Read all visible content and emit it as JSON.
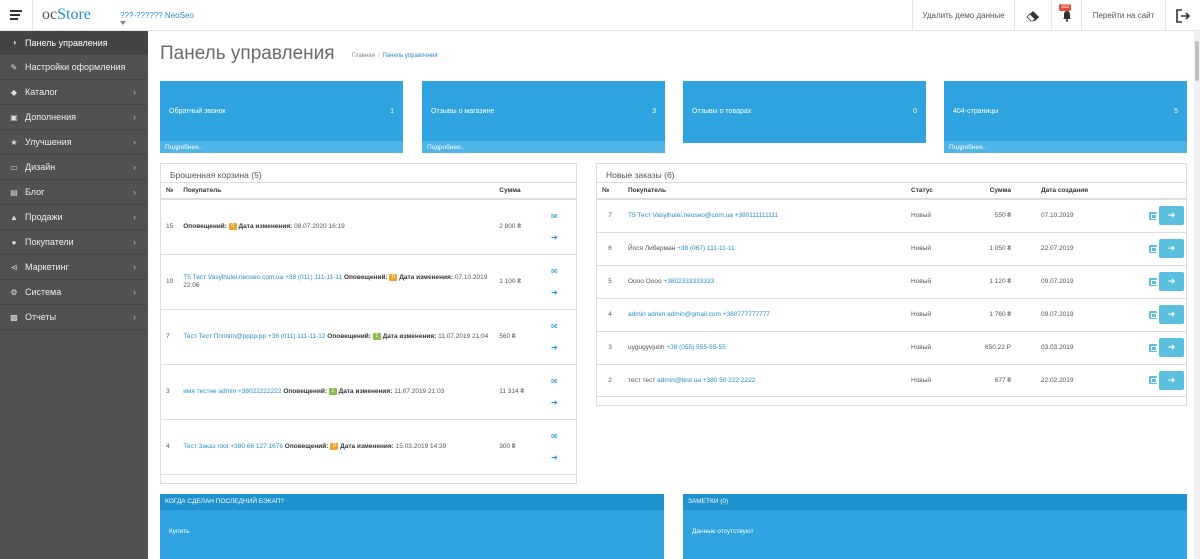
{
  "header": {
    "logo_prefix": "oc",
    "logo_main": "Store",
    "store_name": "???-?????? NeoSeo",
    "delete_demo": "Удалить демо данные",
    "notif_count": "332",
    "go_to_site": "Перейти на сайт"
  },
  "sidebar": {
    "items": [
      {
        "label": "Панель управления",
        "icon": "dashboard-icon"
      },
      {
        "label": "Настройки оформления",
        "icon": "brush-icon"
      },
      {
        "label": "Каталог",
        "icon": "tag-icon"
      },
      {
        "label": "Дополнения",
        "icon": "puzzle-icon"
      },
      {
        "label": "Улучшения",
        "icon": "star-icon"
      },
      {
        "label": "Дизайн",
        "icon": "monitor-icon"
      },
      {
        "label": "Блог",
        "icon": "blog-icon"
      },
      {
        "label": "Продажи",
        "icon": "cart-icon"
      },
      {
        "label": "Покупатели",
        "icon": "user-icon"
      },
      {
        "label": "Маркетинг",
        "icon": "share-icon"
      },
      {
        "label": "Система",
        "icon": "cog-icon"
      },
      {
        "label": "Отчеты",
        "icon": "bar-chart-icon"
      }
    ]
  },
  "page": {
    "title": "Панель управления",
    "breadcrumb_home": "Главная",
    "breadcrumb_current": "Панель управления"
  },
  "tiles": [
    {
      "title": "Обратный звонок",
      "value": "1",
      "more": "Подробнее.."
    },
    {
      "title": "Отзывы о магазине",
      "value": "3",
      "more": "Подробнее.."
    },
    {
      "title": "Отзывы о товарах",
      "value": "0",
      "more": ""
    },
    {
      "title": "404-страницы",
      "value": "5",
      "more": "Подробнее.."
    }
  ],
  "abandoned": {
    "title": "Брошенная корзина (5)",
    "cols": {
      "num": "№",
      "customer": "Покупатель",
      "sum": "Сумма"
    },
    "notif_label": "Оповещений:",
    "date_label": "Дата изменения:",
    "rows": [
      {
        "num": "15",
        "customer": "",
        "notif": "0",
        "date": "08.07.2020 16:19",
        "sum": "2 800 ₴"
      },
      {
        "num": "10",
        "customer": "T5 Тест Vasylhulei.neoseo.com.ua +38 (011) 111-11-11",
        "notif": "0",
        "date": "07.10.2019 22:06",
        "sum": "1 100 ₴"
      },
      {
        "num": "7",
        "customer": "Тест Тест Пппппп@pppp.pp +38 (011) 111-11-12",
        "notif": "1",
        "date": "11.07.2019 21:04",
        "sum": "560 ₴"
      },
      {
        "num": "3",
        "customer": "имя тестне admin +38022222222",
        "notif": "1",
        "date": "11.07.2019 21:03",
        "sum": "11 314 ₴"
      },
      {
        "num": "4",
        "customer": "Тест Заказ root +380 66 127 1676",
        "notif": "0",
        "date": "15.03.2019 14:39",
        "sum": "300 ₴"
      }
    ]
  },
  "orders": {
    "title": "Новые заказы (6)",
    "cols": {
      "num": "№",
      "customer": "Покупатель",
      "status": "Статус",
      "sum": "Сумма",
      "date": "Дата создания"
    },
    "rows": [
      {
        "num": "7",
        "name": "",
        "contact": "T5 Тест Vasylhulei.neoseo@com.ua +380111111111",
        "status": "Новый",
        "sum": "550 ₴",
        "date": "07.10.2019"
      },
      {
        "num": "6",
        "name": "Йося Либерман",
        "contact": "+38 (067) 111-11-11",
        "status": "Новый",
        "sum": "1 050 ₴",
        "date": "22.07.2019"
      },
      {
        "num": "5",
        "name": "Оооо Оооо",
        "contact": "+3802333333333",
        "status": "Новый",
        "sum": "1 120 ₴",
        "date": "09.07.2019"
      },
      {
        "num": "4",
        "name": "",
        "contact": "admin admin admin@gmail.com +380777777777",
        "status": "Новый",
        "sum": "1 760 ₴",
        "date": "09.07.2019"
      },
      {
        "num": "3",
        "name": "uygugyvjubh",
        "contact": "+38 (055) 555-55-55",
        "status": "Новый",
        "sum": "650.22 Р",
        "date": "03.03.2019"
      },
      {
        "num": "2",
        "name": "тест тест",
        "contact": "admin@test.ua +380 50 222 2222",
        "status": "Новый",
        "sum": "677 ₴",
        "date": "22.02.2019"
      }
    ]
  },
  "backup": {
    "title": "КОГДА СДЕЛАН ПОСЛЕДНИЙ БЭКАП?",
    "body": "Купить"
  },
  "notes": {
    "title": "ЗАМЕТКИ (0)",
    "body": "Данные отсутствуют"
  },
  "colors": {
    "accent": "#1e91cf",
    "tile": "#2ea3e0",
    "sidebar": "#515151",
    "badge_orange": "#f0a330",
    "badge_green": "#8fbc52"
  }
}
